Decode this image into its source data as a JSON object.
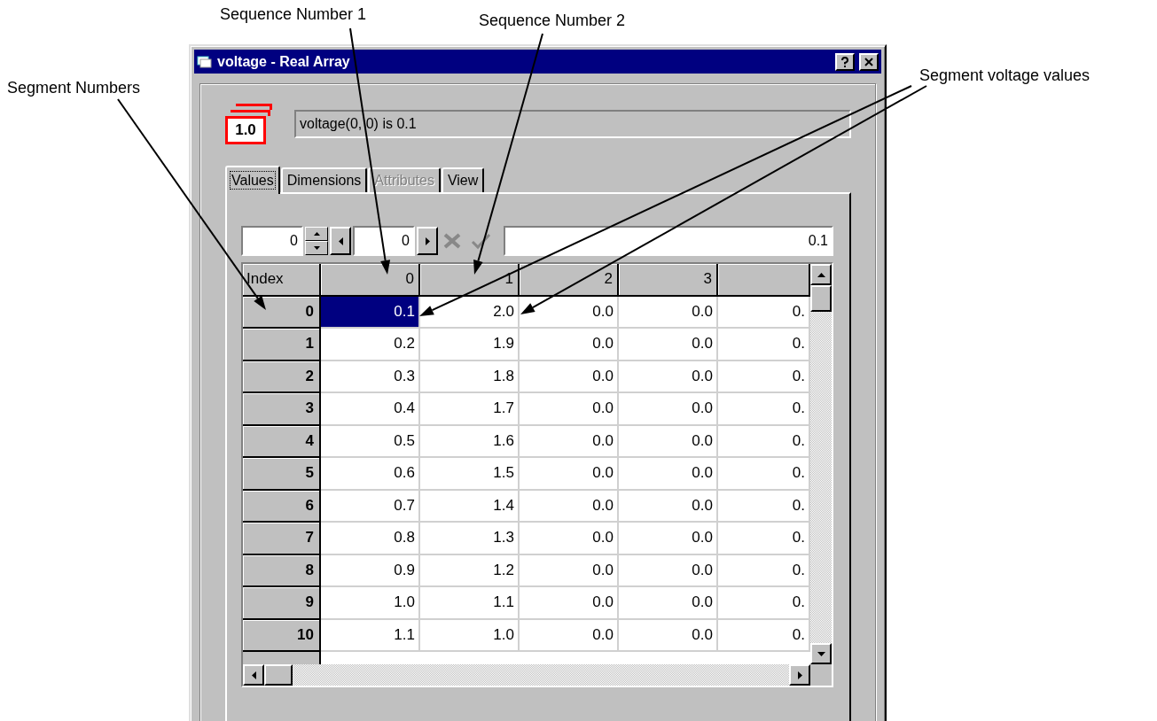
{
  "annotations": [
    {
      "label": "Sequence Number 1"
    },
    {
      "label": "Sequence Number 2"
    },
    {
      "label": "Segment Numbers"
    },
    {
      "label": "Segment voltage values"
    }
  ],
  "window": {
    "title": "voltage - Real Array"
  },
  "type_badge": "1.0",
  "status": "voltage(0, 0) is 0.1",
  "tabs": [
    {
      "label": "Values",
      "selected": true,
      "disabled": false
    },
    {
      "label": "Dimensions",
      "selected": false,
      "disabled": false
    },
    {
      "label": "Attributes",
      "selected": false,
      "disabled": true
    },
    {
      "label": "View",
      "selected": false,
      "disabled": false
    }
  ],
  "toolbar": {
    "row_index": "0",
    "column_index": "0",
    "cell_value": "0.1"
  },
  "grid": {
    "corner": "Index",
    "columns": [
      "0",
      "1",
      "2",
      "3"
    ],
    "rows": [
      {
        "index": "0",
        "cells": [
          {
            "value": "0.1",
            "selected": true
          },
          {
            "value": "2.0",
            "selected": false
          },
          {
            "value": "0.0",
            "selected": false
          },
          {
            "value": "0.0",
            "selected": false
          },
          {
            "value": "0.",
            "selected": false
          }
        ]
      },
      {
        "index": "1",
        "cells": [
          {
            "value": "0.2",
            "selected": false
          },
          {
            "value": "1.9",
            "selected": false
          },
          {
            "value": "0.0",
            "selected": false
          },
          {
            "value": "0.0",
            "selected": false
          },
          {
            "value": "0.",
            "selected": false
          }
        ]
      },
      {
        "index": "2",
        "cells": [
          {
            "value": "0.3",
            "selected": false
          },
          {
            "value": "1.8",
            "selected": false
          },
          {
            "value": "0.0",
            "selected": false
          },
          {
            "value": "0.0",
            "selected": false
          },
          {
            "value": "0.",
            "selected": false
          }
        ]
      },
      {
        "index": "3",
        "cells": [
          {
            "value": "0.4",
            "selected": false
          },
          {
            "value": "1.7",
            "selected": false
          },
          {
            "value": "0.0",
            "selected": false
          },
          {
            "value": "0.0",
            "selected": false
          },
          {
            "value": "0.",
            "selected": false
          }
        ]
      },
      {
        "index": "4",
        "cells": [
          {
            "value": "0.5",
            "selected": false
          },
          {
            "value": "1.6",
            "selected": false
          },
          {
            "value": "0.0",
            "selected": false
          },
          {
            "value": "0.0",
            "selected": false
          },
          {
            "value": "0.",
            "selected": false
          }
        ]
      },
      {
        "index": "5",
        "cells": [
          {
            "value": "0.6",
            "selected": false
          },
          {
            "value": "1.5",
            "selected": false
          },
          {
            "value": "0.0",
            "selected": false
          },
          {
            "value": "0.0",
            "selected": false
          },
          {
            "value": "0.",
            "selected": false
          }
        ]
      },
      {
        "index": "6",
        "cells": [
          {
            "value": "0.7",
            "selected": false
          },
          {
            "value": "1.4",
            "selected": false
          },
          {
            "value": "0.0",
            "selected": false
          },
          {
            "value": "0.0",
            "selected": false
          },
          {
            "value": "0.",
            "selected": false
          }
        ]
      },
      {
        "index": "7",
        "cells": [
          {
            "value": "0.8",
            "selected": false
          },
          {
            "value": "1.3",
            "selected": false
          },
          {
            "value": "0.0",
            "selected": false
          },
          {
            "value": "0.0",
            "selected": false
          },
          {
            "value": "0.",
            "selected": false
          }
        ]
      },
      {
        "index": "8",
        "cells": [
          {
            "value": "0.9",
            "selected": false
          },
          {
            "value": "1.2",
            "selected": false
          },
          {
            "value": "0.0",
            "selected": false
          },
          {
            "value": "0.0",
            "selected": false
          },
          {
            "value": "0.",
            "selected": false
          }
        ]
      },
      {
        "index": "9",
        "cells": [
          {
            "value": "1.0",
            "selected": false
          },
          {
            "value": "1.1",
            "selected": false
          },
          {
            "value": "0.0",
            "selected": false
          },
          {
            "value": "0.0",
            "selected": false
          },
          {
            "value": "0.",
            "selected": false
          }
        ]
      },
      {
        "index": "10",
        "cells": [
          {
            "value": "1.1",
            "selected": false
          },
          {
            "value": "1.0",
            "selected": false
          },
          {
            "value": "0.0",
            "selected": false
          },
          {
            "value": "0.0",
            "selected": false
          },
          {
            "value": "0.",
            "selected": false
          }
        ]
      }
    ]
  }
}
